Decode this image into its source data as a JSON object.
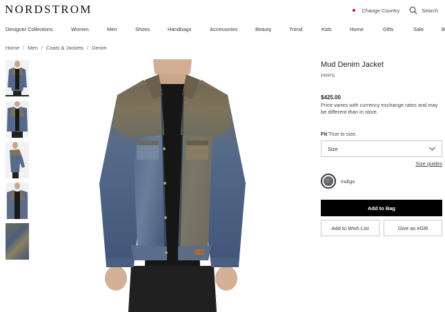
{
  "header": {
    "logo": "NORDSTROM",
    "change_country": "Change Country",
    "search_label": "Search"
  },
  "nav": {
    "items": [
      "Designer Collections",
      "Women",
      "Men",
      "Shoes",
      "Handbags",
      "Accessories",
      "Beauty",
      "Trend",
      "Kids",
      "Home",
      "Gifts",
      "Sale",
      "B"
    ]
  },
  "breadcrumb": [
    "Home",
    "Men",
    "Coats & Jackets",
    "Denim"
  ],
  "product": {
    "title": "Mud Denim Jacket",
    "brand": "PRPS",
    "price": "$425.00",
    "price_note": "Price varies with currency exchange rates and may be different than in store.",
    "fit_label": "Fit",
    "fit_value": "True to size.",
    "size_placeholder": "Size",
    "size_guides": "Size guides",
    "color_name": "Indigo",
    "add_to_bag": "Add to Bag",
    "add_to_wishlist": "Add to Wish List",
    "give_egift": "Give as eGift"
  },
  "colors": {
    "accent_dot": "#c0102f",
    "button_bg": "#000000"
  }
}
